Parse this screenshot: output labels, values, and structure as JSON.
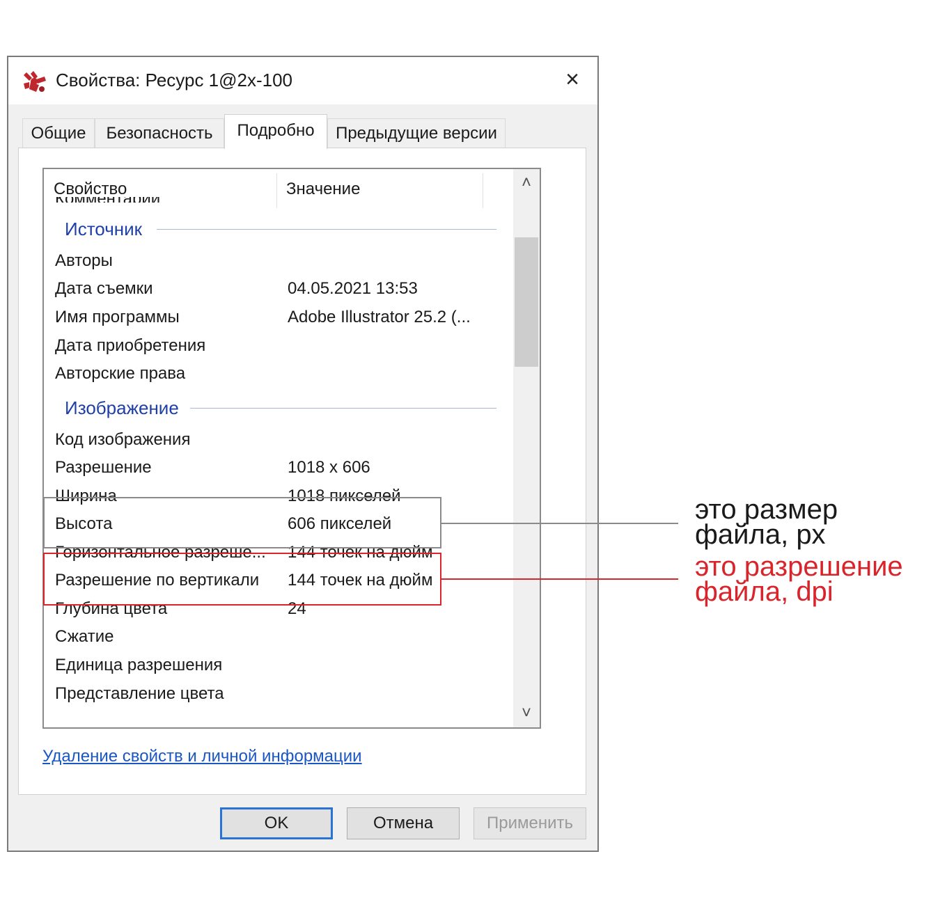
{
  "window": {
    "title": "Свойства: Ресурс 1@2x-100",
    "close_icon": "×"
  },
  "tabs": [
    {
      "label": "Общие",
      "active": false
    },
    {
      "label": "Безопасность",
      "active": false
    },
    {
      "label": "Подробно",
      "active": true
    },
    {
      "label": "Предыдущие версии",
      "active": false
    }
  ],
  "list": {
    "headers": {
      "property": "Свойство",
      "value": "Значение"
    },
    "partial_row": "Комментарии",
    "groups": {
      "source": "Источник",
      "image": "Изображение"
    },
    "source_rows": [
      {
        "prop": "Авторы",
        "val": ""
      },
      {
        "prop": "Дата съемки",
        "val": "04.05.2021 13:53"
      },
      {
        "prop": "Имя программы",
        "val": "Adobe Illustrator 25.2 (..."
      },
      {
        "prop": "Дата приобретения",
        "val": ""
      },
      {
        "prop": "Авторские права",
        "val": ""
      }
    ],
    "image_rows": [
      {
        "prop": "Код изображения",
        "val": ""
      },
      {
        "prop": "Разрешение",
        "val": "1018 x 606"
      },
      {
        "prop": "Ширина",
        "val": "1018 пикселей"
      },
      {
        "prop": "Высота",
        "val": "606 пикселей"
      },
      {
        "prop": "Горизонтальное разреше...",
        "val": "144 точек на дюйм"
      },
      {
        "prop": "Разрешение по вертикали",
        "val": "144 точек на дюйм"
      },
      {
        "prop": "Глубина цвета",
        "val": "24"
      },
      {
        "prop": "Сжатие",
        "val": ""
      },
      {
        "prop": "Единица разрешения",
        "val": ""
      },
      {
        "prop": "Представление цвета",
        "val": ""
      }
    ],
    "scroll_up_icon": "˄",
    "scroll_down_icon": "˅"
  },
  "link": "Удаление свойств и личной информации",
  "buttons": {
    "ok": "OK",
    "cancel": "Отмена",
    "apply": "Применить"
  },
  "annotations": {
    "size_note": [
      "это размер",
      "файла, px"
    ],
    "dpi_note": [
      "это разрешение",
      "файла, dpi"
    ],
    "size_color": "#1a1a1a",
    "dpi_color": "#d9242b"
  }
}
